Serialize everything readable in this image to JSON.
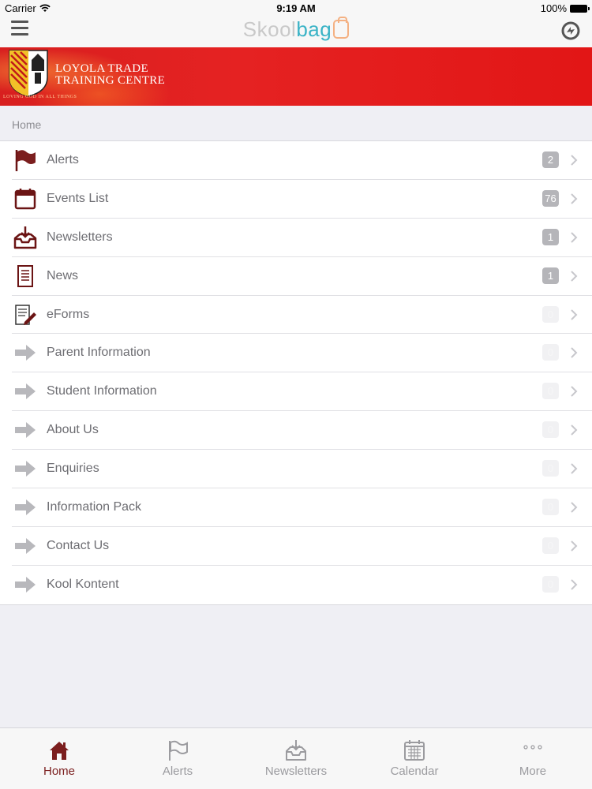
{
  "status_bar": {
    "carrier": "Carrier",
    "time": "9:19 AM",
    "battery": "100%"
  },
  "nav": {
    "brand_part1": "Skool",
    "brand_part2": "bag",
    "menu_icon": "hamburger-icon",
    "sync_icon": "sync-icon"
  },
  "banner": {
    "line1": "LOYOLA TRADE",
    "line2": "TRAINING CENTRE",
    "motto": "LOVING GOD IN ALL THINGS"
  },
  "breadcrumb": "Home",
  "colors": {
    "accent": "#7b1e1e",
    "banner_red": "#e21616",
    "badge_gray": "#b5b5b9",
    "arrow_gray": "#b8b8bc"
  },
  "menu": [
    {
      "label": "Alerts",
      "badge": "2",
      "icon": "flag-icon",
      "badge_active": true
    },
    {
      "label": "Events List",
      "badge": "76",
      "icon": "calendar-icon",
      "badge_active": true
    },
    {
      "label": "Newsletters",
      "badge": "1",
      "icon": "inbox-download-icon",
      "badge_active": true
    },
    {
      "label": "News",
      "badge": "1",
      "icon": "document-icon",
      "badge_active": true
    },
    {
      "label": "eForms",
      "badge": "0",
      "icon": "form-pencil-icon",
      "badge_active": false
    },
    {
      "label": "Parent Information",
      "badge": "0",
      "icon": "arrow-right-icon",
      "badge_active": false
    },
    {
      "label": "Student Information",
      "badge": "0",
      "icon": "arrow-right-icon",
      "badge_active": false
    },
    {
      "label": "About Us",
      "badge": "0",
      "icon": "arrow-right-icon",
      "badge_active": false
    },
    {
      "label": "Enquiries",
      "badge": "0",
      "icon": "arrow-right-icon",
      "badge_active": false
    },
    {
      "label": "Information Pack",
      "badge": "0",
      "icon": "arrow-right-icon",
      "badge_active": false
    },
    {
      "label": "Contact Us",
      "badge": "0",
      "icon": "arrow-right-icon",
      "badge_active": false
    },
    {
      "label": "Kool Kontent",
      "badge": "0",
      "icon": "arrow-right-icon",
      "badge_active": false
    }
  ],
  "tabs": [
    {
      "label": "Home",
      "icon": "home-icon",
      "active": true
    },
    {
      "label": "Alerts",
      "icon": "flag-icon",
      "active": false
    },
    {
      "label": "Newsletters",
      "icon": "inbox-download-icon",
      "active": false
    },
    {
      "label": "Calendar",
      "icon": "calendar-icon",
      "active": false
    },
    {
      "label": "More",
      "icon": "more-dots-icon",
      "active": false
    }
  ]
}
